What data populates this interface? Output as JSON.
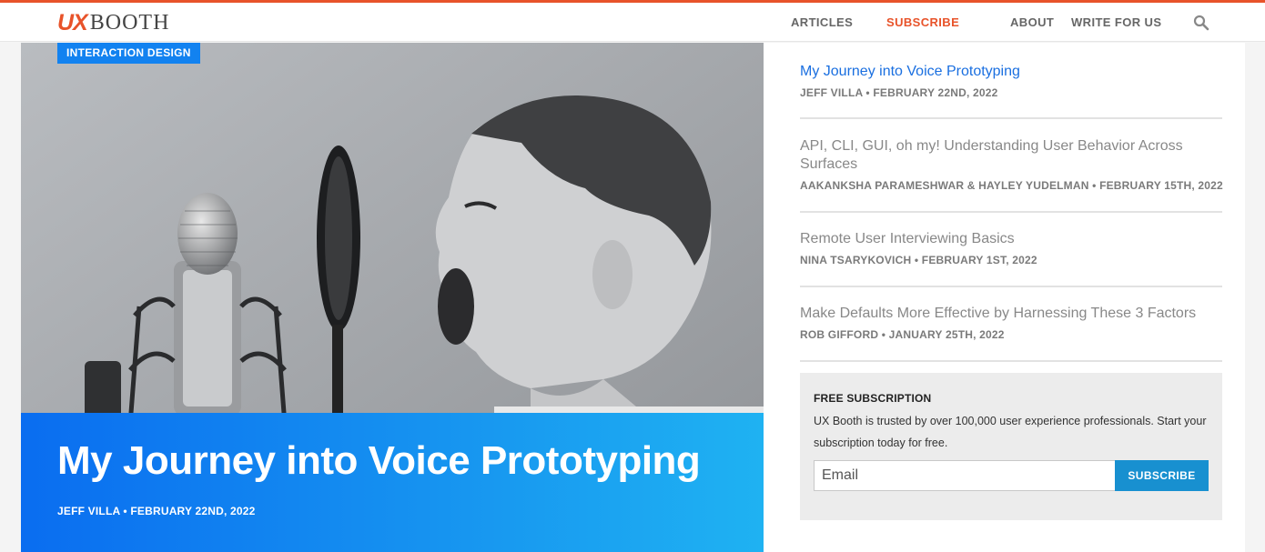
{
  "site": {
    "logo_ux": "UX",
    "logo_booth": "BOOTH"
  },
  "nav": {
    "items": [
      {
        "label": "ARTICLES",
        "active": false
      },
      {
        "label": "SUBSCRIBE",
        "active": true
      },
      {
        "label": "ABOUT",
        "active": false
      },
      {
        "label": "WRITE FOR US",
        "active": false
      }
    ],
    "search_icon": "search-icon"
  },
  "featured": {
    "category": "INTERACTION DESIGN",
    "title": "My Journey into Voice Prototyping",
    "meta": "JEFF VILLA • FEBRUARY 22ND, 2022",
    "image": "boy-shouting-into-studio-microphone"
  },
  "articles": [
    {
      "title": "My Journey into Voice Prototyping",
      "meta": "JEFF VILLA • FEBRUARY 22ND, 2022"
    },
    {
      "title": "API, CLI, GUI, oh my! Understanding User Behavior Across Surfaces",
      "meta": "AAKANKSHA PARAMESHWAR & HAYLEY YUDELMAN • FEBRUARY 15TH, 2022"
    },
    {
      "title": "Remote User Interviewing Basics",
      "meta": "NINA TSARYKOVICH • FEBRUARY 1ST, 2022"
    },
    {
      "title": "Make Defaults More Effective by Harnessing These 3 Factors",
      "meta": "ROB GIFFORD • JANUARY 25TH, 2022"
    }
  ],
  "subscription": {
    "heading": "FREE SUBSCRIPTION",
    "text": "UX Booth is trusted by over 100,000 user experience professionals. Start your subscription today for free.",
    "email_placeholder": "Email",
    "button_label": "SUBSCRIBE"
  },
  "colors": {
    "brand_orange": "#e8532a",
    "link_blue": "#1a6fe0",
    "hero_blue": "#0a6df0",
    "button_blue": "#1890d0"
  }
}
